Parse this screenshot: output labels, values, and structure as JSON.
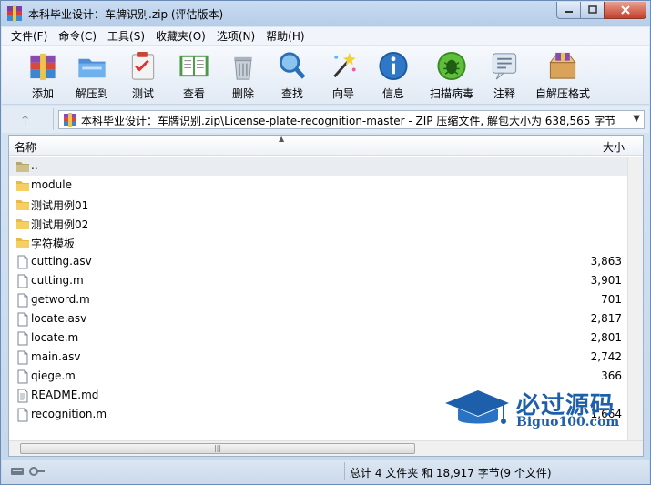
{
  "window": {
    "title": "本科毕业设计：车牌识别.zip (评估版本)"
  },
  "menu": [
    "文件(F)",
    "命令(C)",
    "工具(S)",
    "收藏夹(O)",
    "选项(N)",
    "帮助(H)"
  ],
  "toolbar": {
    "add": "添加",
    "extract": "解压到",
    "test": "测试",
    "view": "查看",
    "delete": "删除",
    "find": "查找",
    "wizard": "向导",
    "info": "信息",
    "scan": "扫描病毒",
    "comment": "注释",
    "sfx": "自解压格式"
  },
  "address": {
    "path": "本科毕业设计：车牌识别.zip\\License-plate-recognition-master - ZIP 压缩文件, 解包大小为 638,565 字节"
  },
  "list": {
    "col_name": "名称",
    "col_size": "大小",
    "rows": [
      {
        "name": "..",
        "size": "",
        "type": "parent"
      },
      {
        "name": "module",
        "size": "",
        "type": "folder"
      },
      {
        "name": "测试用例01",
        "size": "",
        "type": "folder"
      },
      {
        "name": "测试用例02",
        "size": "",
        "type": "folder"
      },
      {
        "name": "字符模板",
        "size": "",
        "type": "folder"
      },
      {
        "name": "cutting.asv",
        "size": "3,863",
        "type": "file"
      },
      {
        "name": "cutting.m",
        "size": "3,901",
        "type": "file"
      },
      {
        "name": "getword.m",
        "size": "701",
        "type": "file"
      },
      {
        "name": "locate.asv",
        "size": "2,817",
        "type": "file"
      },
      {
        "name": "locate.m",
        "size": "2,801",
        "type": "file"
      },
      {
        "name": "main.asv",
        "size": "2,742",
        "type": "file"
      },
      {
        "name": "qiege.m",
        "size": "366",
        "type": "file"
      },
      {
        "name": "README.md",
        "size": "",
        "type": "textfile"
      },
      {
        "name": "recognition.m",
        "size": "1,664",
        "type": "file"
      }
    ]
  },
  "status": {
    "summary": "总计 4 文件夹 和 18,917 字节(9 个文件)"
  },
  "watermark": {
    "title": "必过源码",
    "sub": "Biguo100.com"
  },
  "colors": {
    "accent": "#1d5faa",
    "folder": "#e8b943"
  }
}
